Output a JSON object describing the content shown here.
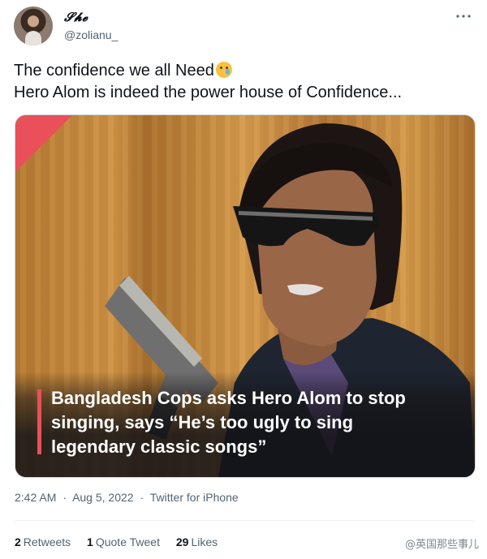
{
  "author": {
    "display_name": "𝓢𝓱𝓮",
    "handle": "@zolianu_"
  },
  "more_icon": "more-horizontal-icon",
  "tweet": {
    "line1": "The confidence we all Need",
    "line2": "Hero Alom is indeed the power house of Confidence...",
    "emoji": "face-holding-back-tears"
  },
  "media": {
    "caption": "Bangladesh Cops asks Hero Alom to stop singing, says “He’s too ugly to sing legendary classic songs”",
    "accent_color": "#e9505a"
  },
  "meta": {
    "time": "2:42 AM",
    "separator": "·",
    "date": "Aug 5, 2022",
    "source": "Twitter for iPhone"
  },
  "stats": {
    "retweets_count": "2",
    "retweets_label": "Retweets",
    "quotes_count": "1",
    "quotes_label": "Quote Tweet",
    "likes_count": "29",
    "likes_label": "Likes"
  },
  "watermark": "@英国那些事儿"
}
